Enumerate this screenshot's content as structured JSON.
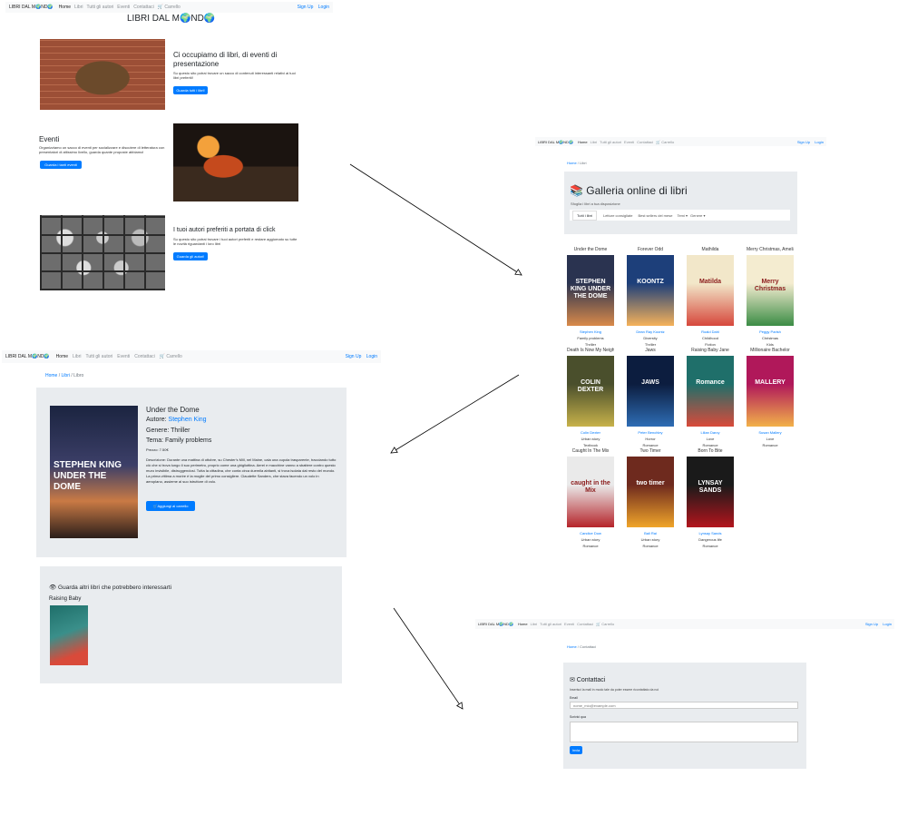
{
  "colors": {
    "primary": "#007bff",
    "jumbotron": "#e9ecef",
    "navbar": "#f8f9fa"
  },
  "nav": {
    "brand": "LIBRI DAL M🌍ND🌍",
    "home": "Home",
    "libri": "Libri",
    "autori": "Tutti gli autori",
    "eventi": "Eventi",
    "contattaci": "Contattaci",
    "carrello": "🛒 Carrello",
    "signup": "Sign Up",
    "login": "Login"
  },
  "home": {
    "title": "LIBRI DAL M🌍ND🌍",
    "sec1_title": "Ci occupiamo di libri, di eventi di presentazione",
    "sec1_text": "Su questo sito potrai trovare un sacco di contenuti interessanti relativi ai tuoi libri preferiti!",
    "sec1_btn": "Guarda tutti i libri!",
    "sec2_title": "Eventi",
    "sec2_text": "Organizziamo un sacco di eventi per socializzare e discutere di letteratura con presentatori di altissimo livello, guarda quante proposte abbiamo!",
    "sec2_btn": "Guarda i tanti eventi",
    "sec3_title": "I tuoi autori preferiti a portata di click",
    "sec3_text": "Su questo sito potrai trovare i tuoi autori preferiti e restare aggiornato su tutte le novità riguardanti i loro libri",
    "sec3_btn": "Guarda gli autori!"
  },
  "gallery": {
    "crumb_home": "Home",
    "crumb_libri": "Libri",
    "title": "📚 Galleria online di libri",
    "subtitle": "Sfoglia i libri a tua disposizione",
    "filters": [
      "Tutti i libri",
      "Letture consigliate",
      "Best sellers del mese",
      "Temi ▾",
      "Genere ▾"
    ],
    "books": [
      {
        "title": "Under the Dome",
        "author": "Stephen King",
        "theme": "Family problems",
        "genre": "Thriller",
        "c1": "#2a3350",
        "c2": "#d98a4a",
        "ctext": "STEPHEN KING UNDER THE DOME"
      },
      {
        "title": "Forever Odd",
        "author": "Dean Ray Koontz",
        "theme": "Diversity",
        "genre": "Thriller",
        "c1": "#1d3f7a",
        "c2": "#f5b25a",
        "ctext": "KOONTZ"
      },
      {
        "title": "Mathilda",
        "author": "Roald Dahl",
        "theme": "Childhood",
        "genre": "Fiction",
        "c1": "#f2e7c9",
        "c2": "#d6473b",
        "ctext": "Matilda"
      },
      {
        "title": "Merry Christmas, Amelia",
        "author": "Peggy Parish",
        "theme": "Christmas",
        "genre": "Kids",
        "c1": "#f4ecd0",
        "c2": "#3b8c45",
        "ctext": "Merry Christmas"
      },
      {
        "title": "Death Is Now My Neighbour",
        "author": "Colin Dexter",
        "theme": "Urban story",
        "genre": "Textbook",
        "c1": "#4a4f2c",
        "c2": "#c7b24a",
        "ctext": "COLIN DEXTER"
      },
      {
        "title": "Jaws",
        "author": "Peter Benchley",
        "theme": "Horror",
        "genre": "Romance",
        "c1": "#0c1d3f",
        "c2": "#2e6db5",
        "ctext": "JAWS"
      },
      {
        "title": "Raising Baby Jane",
        "author": "Lilian Darcy",
        "theme": "Love",
        "genre": "Romance",
        "c1": "#1f6f6a",
        "c2": "#d94a3a",
        "ctext": "Romance"
      },
      {
        "title": "Millionaire Bachelor",
        "author": "Susan Mallery",
        "theme": "Love",
        "genre": "Romance",
        "c1": "#b0185a",
        "c2": "#f2b14a",
        "ctext": "MALLERY"
      },
      {
        "title": "Caught In The Mix",
        "author": "Candice Dow",
        "theme": "Urban story",
        "genre": "Romance",
        "c1": "#eaeaea",
        "c2": "#b5242a",
        "ctext": "caught in the Mix"
      },
      {
        "title": "Two Timer",
        "author": "Bali Rai",
        "theme": "Urban story",
        "genre": "Romance",
        "c1": "#6e2a1e",
        "c2": "#f0a52a",
        "ctext": "two timer"
      },
      {
        "title": "Born To Bite",
        "author": "Lynsay Sands",
        "theme": "Dangerous life",
        "genre": "Romance",
        "c1": "#1a1a1a",
        "c2": "#b3151d",
        "ctext": "LYNSAY SANDS"
      }
    ]
  },
  "detail": {
    "crumb_home": "Home",
    "crumb_libri": "Libri",
    "crumb_cur": "Libro",
    "title": "Under the Dome",
    "author_label": "Autore:",
    "author": "Stephen King",
    "genre": "Genere: Thriller",
    "theme": "Tema: Family problems",
    "price": "Prezzo: 7.50€",
    "description": "Descrizione: Durante una mattina di ottobre, su Chester's Mill, nel Maine, cala una cupola trasparente, tracciando tutto ciò che si trova lungo il suo perimetro, proprio come una ghigliottina. Aerei e macchine vanno a sbattere contro questo muro invisibile, distruggendosi. Tutta la cittadina, che conta circa duemila abitanti, si trova isolata dal resto del mondo. La prima vittima a morire è la moglie del primo consigliere. Claudette Sanders, che stava facendo un volo in aeroplano, assieme al suo istruttore di volo.",
    "cart_btn": "🛒Aggiungi al carrello",
    "cover_text": "STEPHEN KING UNDER THE DOME",
    "related_title": "👁 Guarda altri libri che potrebbero interessarti",
    "related_book": "Raising Baby"
  },
  "contact": {
    "crumb_home": "Home",
    "crumb_cur": "Contattaci",
    "title": "✉ Contattaci",
    "subtitle": "Inserisci la mail in modo tale da poter essere ricontattato da noi",
    "email_label": "Email",
    "email_placeholder": "nome_mio@example.com",
    "text_label": "Scrivici qua",
    "submit": "Invia"
  }
}
